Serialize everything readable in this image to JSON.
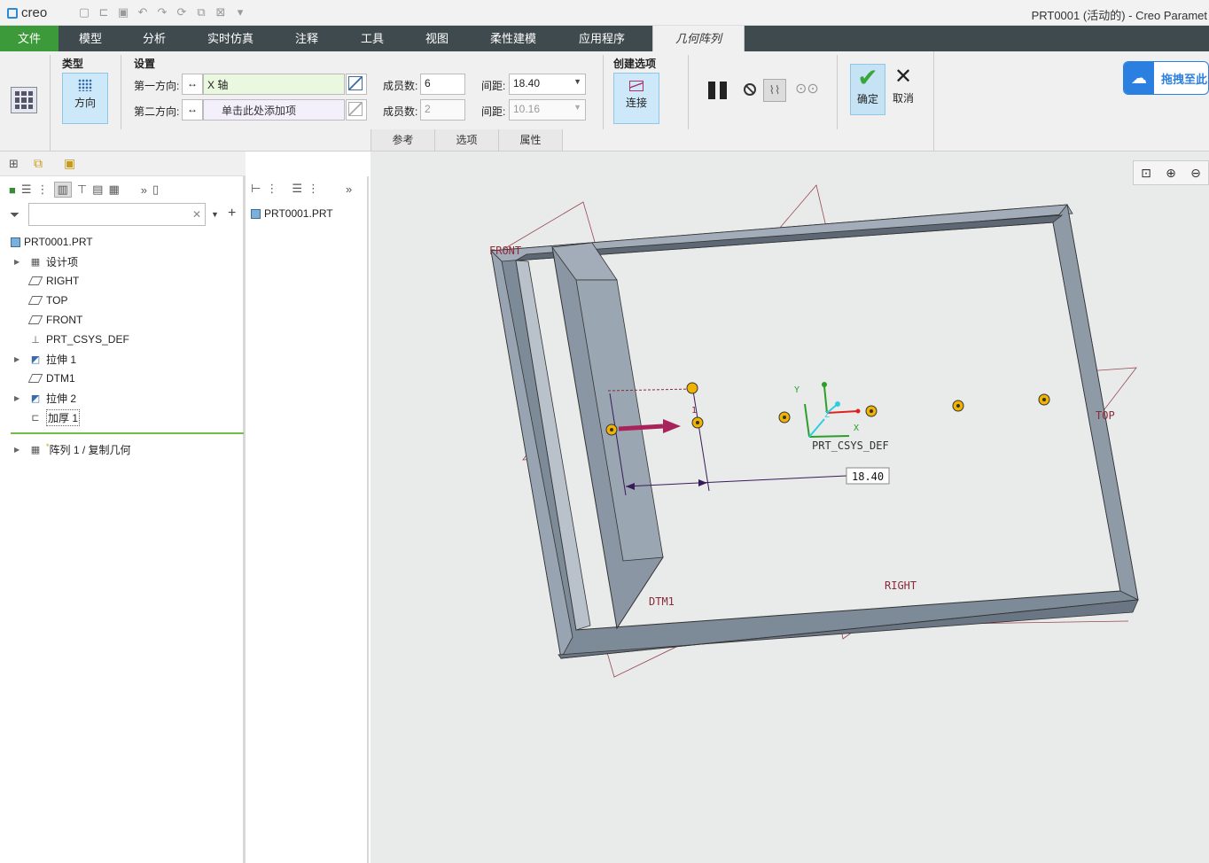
{
  "titlebar": {
    "logo": "creo",
    "title": "PRT0001 (活动的) - Creo Paramet"
  },
  "menu": {
    "tabs": [
      {
        "label": "文件"
      },
      {
        "label": "模型"
      },
      {
        "label": "分析"
      },
      {
        "label": "实时仿真"
      },
      {
        "label": "注释"
      },
      {
        "label": "工具"
      },
      {
        "label": "视图"
      },
      {
        "label": "柔性建模"
      },
      {
        "label": "应用程序"
      },
      {
        "label": "几何阵列"
      }
    ]
  },
  "ribbon": {
    "type_label": "类型",
    "type_button": "方向",
    "settings_label": "设置",
    "dir1_label": "第一方向:",
    "dir1_value": "X 轴",
    "dir2_label": "第二方向:",
    "dir2_placeholder": "单击此处添加项",
    "members1_label": "成员数:",
    "members1_value": "6",
    "members2_label": "成员数:",
    "members2_value": "2",
    "spacing1_label": "间距:",
    "spacing1_value": "18.40",
    "spacing2_label": "间距:",
    "spacing2_value": "10.16",
    "create_label": "创建选项",
    "connect_button": "连接",
    "ok_button": "确定",
    "cancel_button": "取消",
    "bottom_tabs": [
      "参考",
      "选项",
      "属性"
    ]
  },
  "drag_button": {
    "label": "拖拽至此"
  },
  "model_tree": {
    "items": [
      {
        "label": "PRT0001.PRT"
      },
      {
        "label": "设计项"
      },
      {
        "label": "RIGHT"
      },
      {
        "label": "TOP"
      },
      {
        "label": "FRONT"
      },
      {
        "label": "PRT_CSYS_DEF"
      },
      {
        "label": "拉伸 1"
      },
      {
        "label": "DTM1"
      },
      {
        "label": "拉伸 2"
      },
      {
        "label": "加厚 1"
      },
      {
        "label": "阵列 1 / 复制几何"
      }
    ]
  },
  "mid_panel": {
    "root": "PRT0001.PRT"
  },
  "viewport": {
    "plane_labels": [
      "FRONT",
      "TOP",
      "RIGHT",
      "DTM1"
    ],
    "csys_label": "PRT_CSYS_DEF",
    "dimension": "18.40",
    "axis_labels": [
      "Y",
      "Z",
      "X",
      "1"
    ]
  },
  "colors": {
    "accent": "#3d9a3a",
    "menubar": "#3f4a4f",
    "viewport_bg": "#e9eaea",
    "model": "#8c98a5"
  }
}
